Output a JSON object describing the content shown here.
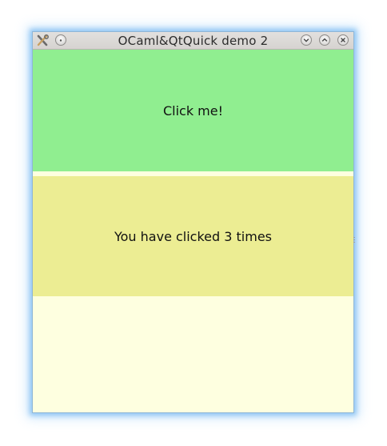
{
  "window": {
    "title": "OCaml&QtQuick demo 2"
  },
  "titlebar": {
    "app_icon": "tools-icon",
    "menu_button_icon": "dot-icon",
    "minimize_icon": "chevron-down-icon",
    "maximize_icon": "chevron-up-icon",
    "close_icon": "close-icon"
  },
  "main": {
    "click_label": "Click me!",
    "counter_text": "You have clicked 3 times"
  },
  "colors": {
    "click_panel": "#90ee90",
    "counter_panel": "#eced93",
    "background": "#feffe0"
  }
}
